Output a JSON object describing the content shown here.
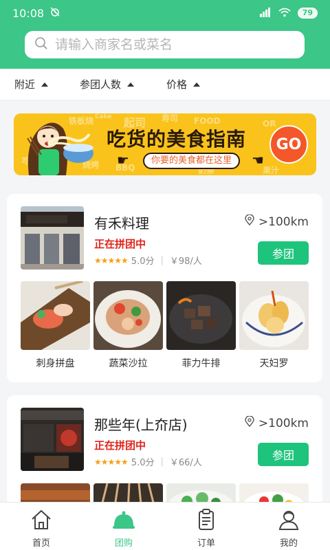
{
  "status_bar": {
    "time": "10:08",
    "battery": "79"
  },
  "search": {
    "placeholder": "请输入商家名或菜名",
    "value": ""
  },
  "filters": [
    {
      "label": "附近"
    },
    {
      "label": "参团人数"
    },
    {
      "label": "价格"
    }
  ],
  "banner": {
    "title": "吃货的美食指南",
    "subtitle": "你要的美食都在这里",
    "go_label": "GO",
    "bg_words": [
      "铁板烧",
      "起司",
      "寿司",
      "FOOD",
      "Cake",
      "OR",
      "奶茶",
      "果汁",
      "吃喝",
      "烧烤",
      "BBQ"
    ]
  },
  "stores": [
    {
      "name": "有禾料理",
      "distance": ">100km",
      "status": "正在拼团中",
      "rating_stars": "★★★★★",
      "rating": "5.0分",
      "price": "￥98/人",
      "join_label": "参团",
      "dishes": [
        {
          "label": "刺身拼盘"
        },
        {
          "label": "蔬菜沙拉"
        },
        {
          "label": "菲力牛排"
        },
        {
          "label": "天妇罗"
        }
      ]
    },
    {
      "name": "那些年(上夼店)",
      "distance": ">100km",
      "status": "正在拼团中",
      "rating_stars": "★★★★★",
      "rating": "5.0分",
      "price": "￥66/人",
      "join_label": "参团"
    }
  ],
  "tabs": [
    {
      "label": "首页",
      "icon": "home-icon"
    },
    {
      "label": "团购",
      "icon": "cloche-icon",
      "active": true
    },
    {
      "label": "订单",
      "icon": "clipboard-icon"
    },
    {
      "label": "我的",
      "icon": "user-icon"
    }
  ],
  "colors": {
    "brand_green": "#3cc687",
    "button_green": "#1ec47c",
    "status_red": "#e0231b",
    "star_orange": "#f4a11a",
    "banner_yellow": "#f9c31c",
    "go_orange": "#f3572a"
  }
}
